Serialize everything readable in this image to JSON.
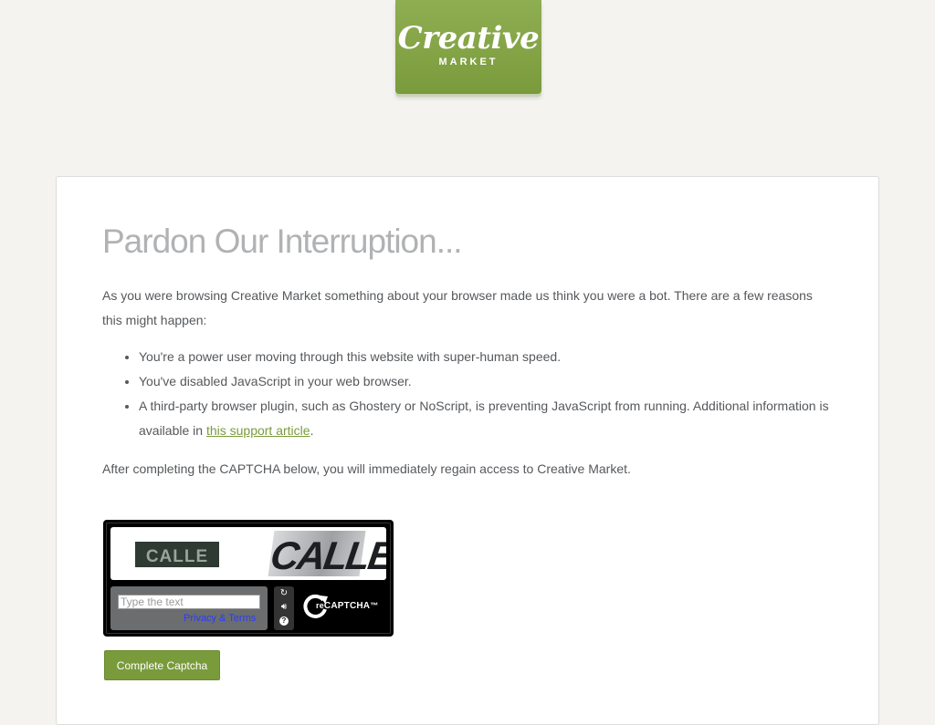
{
  "logo": {
    "brand": "Creative",
    "sub": "MARKET",
    "colors": {
      "green": "#7a9b3c",
      "text": "#ffffff"
    }
  },
  "main": {
    "heading": "Pardon Our Interruption...",
    "intro": "As you were browsing Creative Market something about your browser made us think you were a bot. There are a few reasons this might happen:",
    "reasons": [
      "You're a power user moving through this website with super-human speed.",
      "You've disabled JavaScript in your web browser.",
      "A third-party browser plugin, such as Ghostery or NoScript, is preventing JavaScript from running. Additional information is available in"
    ],
    "support_link": "this support article",
    "support_suffix": ".",
    "after_text": "After completing the CAPTCHA below, you will immediately regain access to Creative Market."
  },
  "captcha": {
    "word1": "CALLE",
    "word2": "CALLE",
    "input_placeholder": "Type the text",
    "privacy_link": "Privacy & Terms",
    "logo_re": "re",
    "logo_text": "CAPTCHA",
    "logo_tm": "™",
    "controls": [
      "refresh-icon",
      "audio-icon",
      "help-icon"
    ]
  },
  "submit_label": "Complete Captcha",
  "colors": {
    "accent": "#7a9b3c",
    "link": "#7a9b3c",
    "heading": "#b0b2b4",
    "body_text": "#55585c",
    "background": "#f4f3f0"
  }
}
